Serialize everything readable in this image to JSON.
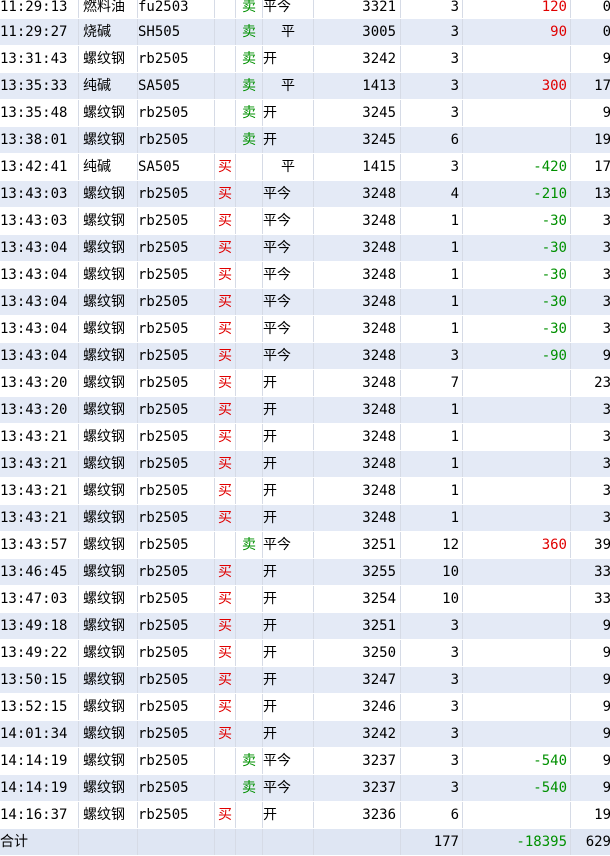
{
  "rows": [
    {
      "time": "11:29:13",
      "name": "燃料油",
      "code": "fu2503",
      "buy": "",
      "sell": "卖",
      "kp": "平今",
      "price": "3321",
      "qty": "3",
      "pnl": "120",
      "sign": "pos",
      "fee": "0"
    },
    {
      "time": "11:29:27",
      "name": "烧碱",
      "code": "SH505",
      "buy": "",
      "sell": "卖",
      "kp": "平",
      "price": "3005",
      "qty": "3",
      "pnl": "90",
      "sign": "pos",
      "fee": "0"
    },
    {
      "time": "13:31:43",
      "name": "螺纹钢",
      "code": "rb2505",
      "buy": "",
      "sell": "卖",
      "kp": "开",
      "price": "3242",
      "qty": "3",
      "pnl": "",
      "sign": "",
      "fee": "9"
    },
    {
      "time": "13:35:33",
      "name": "纯碱",
      "code": "SA505",
      "buy": "",
      "sell": "卖",
      "kp": "平",
      "price": "1413",
      "qty": "3",
      "pnl": "300",
      "sign": "pos",
      "fee": "17"
    },
    {
      "time": "13:35:48",
      "name": "螺纹钢",
      "code": "rb2505",
      "buy": "",
      "sell": "卖",
      "kp": "开",
      "price": "3245",
      "qty": "3",
      "pnl": "",
      "sign": "",
      "fee": "9"
    },
    {
      "time": "13:38:01",
      "name": "螺纹钢",
      "code": "rb2505",
      "buy": "",
      "sell": "卖",
      "kp": "开",
      "price": "3245",
      "qty": "6",
      "pnl": "",
      "sign": "",
      "fee": "19"
    },
    {
      "time": "13:42:41",
      "name": "纯碱",
      "code": "SA505",
      "buy": "买",
      "sell": "",
      "kp": "平",
      "price": "1415",
      "qty": "3",
      "pnl": "-420",
      "sign": "neg",
      "fee": "17"
    },
    {
      "time": "13:43:03",
      "name": "螺纹钢",
      "code": "rb2505",
      "buy": "买",
      "sell": "",
      "kp": "平今",
      "price": "3248",
      "qty": "4",
      "pnl": "-210",
      "sign": "neg",
      "fee": "13"
    },
    {
      "time": "13:43:03",
      "name": "螺纹钢",
      "code": "rb2505",
      "buy": "买",
      "sell": "",
      "kp": "平今",
      "price": "3248",
      "qty": "1",
      "pnl": "-30",
      "sign": "neg",
      "fee": "3"
    },
    {
      "time": "13:43:04",
      "name": "螺纹钢",
      "code": "rb2505",
      "buy": "买",
      "sell": "",
      "kp": "平今",
      "price": "3248",
      "qty": "1",
      "pnl": "-30",
      "sign": "neg",
      "fee": "3"
    },
    {
      "time": "13:43:04",
      "name": "螺纹钢",
      "code": "rb2505",
      "buy": "买",
      "sell": "",
      "kp": "平今",
      "price": "3248",
      "qty": "1",
      "pnl": "-30",
      "sign": "neg",
      "fee": "3"
    },
    {
      "time": "13:43:04",
      "name": "螺纹钢",
      "code": "rb2505",
      "buy": "买",
      "sell": "",
      "kp": "平今",
      "price": "3248",
      "qty": "1",
      "pnl": "-30",
      "sign": "neg",
      "fee": "3"
    },
    {
      "time": "13:43:04",
      "name": "螺纹钢",
      "code": "rb2505",
      "buy": "买",
      "sell": "",
      "kp": "平今",
      "price": "3248",
      "qty": "1",
      "pnl": "-30",
      "sign": "neg",
      "fee": "3"
    },
    {
      "time": "13:43:04",
      "name": "螺纹钢",
      "code": "rb2505",
      "buy": "买",
      "sell": "",
      "kp": "平今",
      "price": "3248",
      "qty": "3",
      "pnl": "-90",
      "sign": "neg",
      "fee": "9"
    },
    {
      "time": "13:43:20",
      "name": "螺纹钢",
      "code": "rb2505",
      "buy": "买",
      "sell": "",
      "kp": "开",
      "price": "3248",
      "qty": "7",
      "pnl": "",
      "sign": "",
      "fee": "23"
    },
    {
      "time": "13:43:20",
      "name": "螺纹钢",
      "code": "rb2505",
      "buy": "买",
      "sell": "",
      "kp": "开",
      "price": "3248",
      "qty": "1",
      "pnl": "",
      "sign": "",
      "fee": "3"
    },
    {
      "time": "13:43:21",
      "name": "螺纹钢",
      "code": "rb2505",
      "buy": "买",
      "sell": "",
      "kp": "开",
      "price": "3248",
      "qty": "1",
      "pnl": "",
      "sign": "",
      "fee": "3"
    },
    {
      "time": "13:43:21",
      "name": "螺纹钢",
      "code": "rb2505",
      "buy": "买",
      "sell": "",
      "kp": "开",
      "price": "3248",
      "qty": "1",
      "pnl": "",
      "sign": "",
      "fee": "3"
    },
    {
      "time": "13:43:21",
      "name": "螺纹钢",
      "code": "rb2505",
      "buy": "买",
      "sell": "",
      "kp": "开",
      "price": "3248",
      "qty": "1",
      "pnl": "",
      "sign": "",
      "fee": "3"
    },
    {
      "time": "13:43:21",
      "name": "螺纹钢",
      "code": "rb2505",
      "buy": "买",
      "sell": "",
      "kp": "开",
      "price": "3248",
      "qty": "1",
      "pnl": "",
      "sign": "",
      "fee": "3"
    },
    {
      "time": "13:43:57",
      "name": "螺纹钢",
      "code": "rb2505",
      "buy": "",
      "sell": "卖",
      "kp": "平今",
      "price": "3251",
      "qty": "12",
      "pnl": "360",
      "sign": "pos",
      "fee": "39"
    },
    {
      "time": "13:46:45",
      "name": "螺纹钢",
      "code": "rb2505",
      "buy": "买",
      "sell": "",
      "kp": "开",
      "price": "3255",
      "qty": "10",
      "pnl": "",
      "sign": "",
      "fee": "33"
    },
    {
      "time": "13:47:03",
      "name": "螺纹钢",
      "code": "rb2505",
      "buy": "买",
      "sell": "",
      "kp": "开",
      "price": "3254",
      "qty": "10",
      "pnl": "",
      "sign": "",
      "fee": "33"
    },
    {
      "time": "13:49:18",
      "name": "螺纹钢",
      "code": "rb2505",
      "buy": "买",
      "sell": "",
      "kp": "开",
      "price": "3251",
      "qty": "3",
      "pnl": "",
      "sign": "",
      "fee": "9"
    },
    {
      "time": "13:49:22",
      "name": "螺纹钢",
      "code": "rb2505",
      "buy": "买",
      "sell": "",
      "kp": "开",
      "price": "3250",
      "qty": "3",
      "pnl": "",
      "sign": "",
      "fee": "9"
    },
    {
      "time": "13:50:15",
      "name": "螺纹钢",
      "code": "rb2505",
      "buy": "买",
      "sell": "",
      "kp": "开",
      "price": "3247",
      "qty": "3",
      "pnl": "",
      "sign": "",
      "fee": "9"
    },
    {
      "time": "13:52:15",
      "name": "螺纹钢",
      "code": "rb2505",
      "buy": "买",
      "sell": "",
      "kp": "开",
      "price": "3246",
      "qty": "3",
      "pnl": "",
      "sign": "",
      "fee": "9"
    },
    {
      "time": "14:01:34",
      "name": "螺纹钢",
      "code": "rb2505",
      "buy": "买",
      "sell": "",
      "kp": "开",
      "price": "3242",
      "qty": "3",
      "pnl": "",
      "sign": "",
      "fee": "9"
    },
    {
      "time": "14:14:19",
      "name": "螺纹钢",
      "code": "rb2505",
      "buy": "",
      "sell": "卖",
      "kp": "平今",
      "price": "3237",
      "qty": "3",
      "pnl": "-540",
      "sign": "neg",
      "fee": "9"
    },
    {
      "time": "14:14:19",
      "name": "螺纹钢",
      "code": "rb2505",
      "buy": "",
      "sell": "卖",
      "kp": "平今",
      "price": "3237",
      "qty": "3",
      "pnl": "-540",
      "sign": "neg",
      "fee": "9"
    },
    {
      "time": "14:16:37",
      "name": "螺纹钢",
      "code": "rb2505",
      "buy": "买",
      "sell": "",
      "kp": "开",
      "price": "3236",
      "qty": "6",
      "pnl": "",
      "sign": "",
      "fee": "19"
    }
  ],
  "total": {
    "label": "合计",
    "qty": "177",
    "pnl": "-18395",
    "fee": "629"
  },
  "colors": {
    "buy": "#e00000",
    "sell": "#009000",
    "row_alt": "#e4eaf6"
  }
}
